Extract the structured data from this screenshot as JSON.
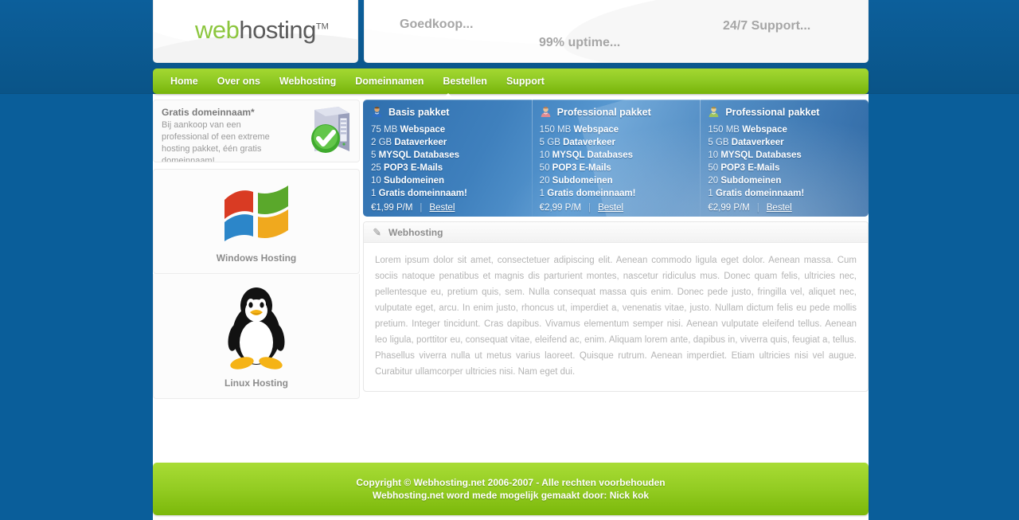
{
  "brand": {
    "logo_primary": "web",
    "logo_secondary": "hosting",
    "logo_tm": "TM"
  },
  "taglines": [
    "Goedkoop...",
    "99% uptime...",
    "24/7 Support..."
  ],
  "nav": {
    "items": [
      {
        "label": "Home",
        "active": false
      },
      {
        "label": "Over ons",
        "active": false
      },
      {
        "label": "Webhosting",
        "active": true
      },
      {
        "label": "Domeinnamen",
        "active": false
      },
      {
        "label": "Bestellen",
        "active": false
      },
      {
        "label": "Support",
        "active": false
      }
    ]
  },
  "sidebar": {
    "promo": {
      "title": "Gratis domeinnaam*",
      "description": "Bij aankoop van een professional of een extreme hosting pakket, één gratis domeinnaam!",
      "icon": "server-check-icon"
    },
    "os_options": [
      {
        "label": "Windows Hosting",
        "icon": "windows-logo-icon"
      },
      {
        "label": "Linux Hosting",
        "icon": "linux-penguin-icon"
      }
    ]
  },
  "packages": [
    {
      "title": "Basis pakket",
      "icon": "user-blue-icon",
      "features": [
        {
          "amount": "75 MB",
          "name": "Webspace"
        },
        {
          "amount": "2 GB",
          "name": "Dataverkeer"
        },
        {
          "amount": "5",
          "name": "MYSQL Databases"
        },
        {
          "amount": "25",
          "name": "POP3 E-Mails"
        },
        {
          "amount": "10",
          "name": "Subdomeinen"
        },
        {
          "amount": "1",
          "name": "Gratis domeinnaam!"
        }
      ],
      "price": "€1,99 P/M",
      "separator": "|",
      "order_label": "Bestel"
    },
    {
      "title": "Professional pakket",
      "icon": "user-red-icon",
      "features": [
        {
          "amount": "150 MB",
          "name": "Webspace"
        },
        {
          "amount": "5 GB",
          "name": "Dataverkeer"
        },
        {
          "amount": "10",
          "name": "MYSQL Databases"
        },
        {
          "amount": "50",
          "name": "POP3 E-Mails"
        },
        {
          "amount": "20",
          "name": "Subdomeinen"
        },
        {
          "amount": "1",
          "name": "Gratis domeinnaam!"
        }
      ],
      "price": "€2,99 P/M",
      "separator": "|",
      "order_label": "Bestel"
    },
    {
      "title": "Professional pakket",
      "icon": "user-green-icon",
      "features": [
        {
          "amount": "150 MB",
          "name": "Webspace"
        },
        {
          "amount": "5 GB",
          "name": "Dataverkeer"
        },
        {
          "amount": "10",
          "name": "MYSQL Databases"
        },
        {
          "amount": "50",
          "name": "POP3 E-Mails"
        },
        {
          "amount": "20",
          "name": "Subdomeinen"
        },
        {
          "amount": "1",
          "name": "Gratis domeinnaam!"
        }
      ],
      "price": "€2,99 P/M",
      "separator": "|",
      "order_label": "Bestel"
    }
  ],
  "content": {
    "icon": "pencil-icon",
    "title": "Webhosting",
    "body": "Lorem ipsum dolor sit amet, consectetuer adipiscing elit. Aenean commodo ligula eget dolor. Aenean massa. Cum sociis natoque penatibus et magnis dis parturient montes, nascetur ridiculus mus. Donec quam felis, ultricies nec, pellentesque eu, pretium quis, sem. Nulla consequat massa quis enim. Donec pede justo, fringilla vel, aliquet nec, vulputate eget, arcu. In enim justo, rhoncus ut, imperdiet a, venenatis vitae, justo. Nullam dictum felis eu pede mollis pretium. Integer tincidunt. Cras dapibus. Vivamus elementum semper nisi. Aenean vulputate eleifend tellus. Aenean leo ligula, porttitor eu, consequat vitae, eleifend ac, enim. Aliquam lorem ante, dapibus in, viverra quis, feugiat a, tellus. Phasellus viverra nulla ut metus varius laoreet. Quisque rutrum. Aenean imperdiet. Etiam ultricies nisi vel augue. Curabitur ullamcorper ultricies nisi. Nam eget dui."
  },
  "footer": {
    "line1": "Copyright © Webhosting.net 2006-2007 - Alle rechten voorbehouden",
    "line2": "Webhosting.net word mede mogelijk gemaakt door: Nick kok"
  },
  "colors": {
    "brand_green": "#8cc63e",
    "nav_green": "#8fc924",
    "panel_blue": "#3f80bd",
    "page_blue": "#0a5e9a"
  }
}
